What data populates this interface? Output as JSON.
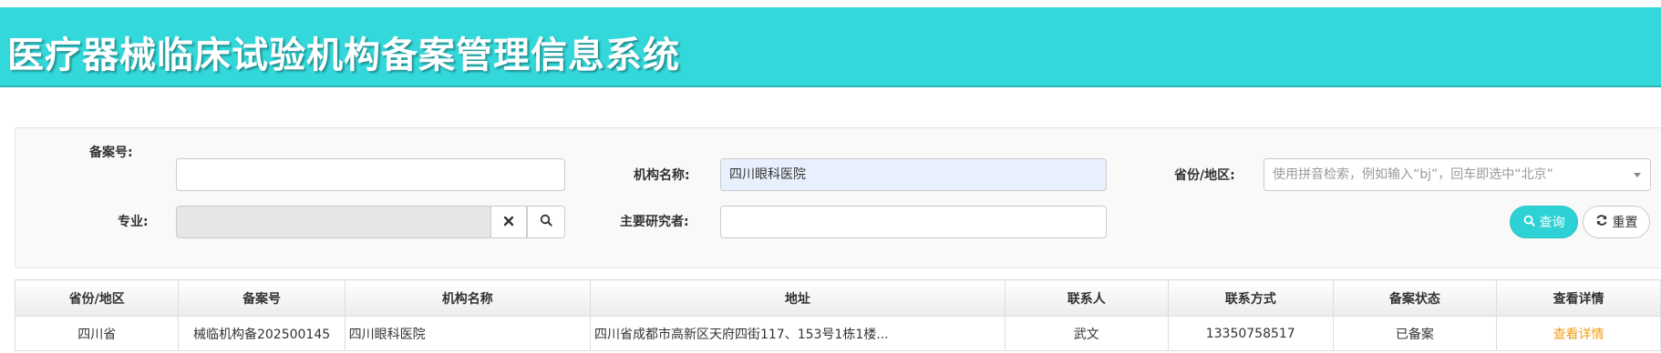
{
  "header": {
    "title": "医疗器械临床试验机构备案管理信息系统",
    "bg_color": "#33d8da"
  },
  "search": {
    "record_no_label": "备案号:",
    "record_no_value": "",
    "org_name_label": "机构名称:",
    "org_name_value": "四川眼科医院",
    "province_label": "省份/地区:",
    "province_placeholder": "使用拼音检索，例如输入“bj”，回车即选中“北京”",
    "specialty_label": "专业:",
    "specialty_value": "",
    "researcher_label": "主要研究者:",
    "researcher_value": "",
    "clear_icon": "close-icon",
    "search_icon": "search-icon",
    "query_button": "查询",
    "reset_button": "重置",
    "accent_color": "#2fd2d4"
  },
  "table": {
    "columns": [
      "省份/地区",
      "备案号",
      "机构名称",
      "地址",
      "联系人",
      "联系方式",
      "备案状态",
      "查看详情"
    ],
    "rows": [
      {
        "province": "四川省",
        "record_no": "械临机构备202500145",
        "org_name": "四川眼科医院",
        "address": "四川省成都市高新区天府四街117、153号1栋1楼...",
        "contact": "武文",
        "phone": "13350758517",
        "status": "已备案",
        "detail": "查看详情"
      }
    ],
    "link_color": "#f39c12"
  }
}
